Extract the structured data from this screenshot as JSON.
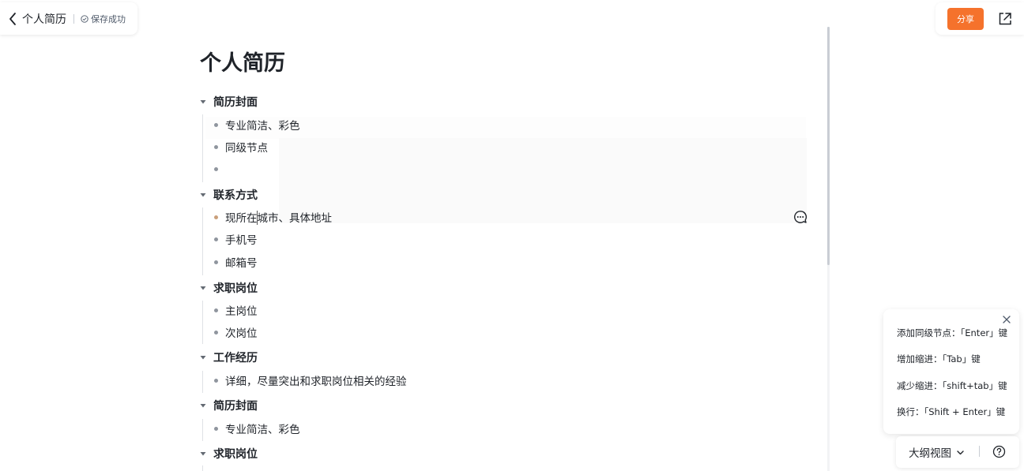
{
  "header": {
    "title": "个人简历",
    "save_status": "保存成功",
    "share_label": "分享",
    "accent_color": "#f5722c"
  },
  "document": {
    "title": "个人简历",
    "sections": [
      {
        "label": "简历封面",
        "items": [
          "专业简洁、彩色",
          "同级节点",
          ""
        ]
      },
      {
        "label": "联系方式",
        "items": [
          "现所在城市、具体地址",
          "手机号",
          "邮箱号"
        ]
      },
      {
        "label": "求职岗位",
        "items": [
          "主岗位",
          "次岗位"
        ]
      },
      {
        "label": "工作经历",
        "items": [
          "详细，尽量突出和求职岗位相关的经验"
        ]
      },
      {
        "label": "简历封面",
        "items": [
          "专业简洁、彩色"
        ]
      },
      {
        "label": "求职岗位",
        "items": []
      }
    ]
  },
  "hints": [
    "添加同级节点：「Enter」键",
    "增加缩进：「Tab」键",
    "减少缩进：「shift+tab」键",
    "换行：「Shift + Enter」键"
  ],
  "view_switcher": {
    "selected": "大纲视图"
  },
  "icons": {
    "back": "chevron-left-icon",
    "saved": "check-circle-icon",
    "open_external": "external-link-icon",
    "comment": "comment-icon",
    "collapse": "caret-down-icon",
    "close": "close-icon",
    "dropdown": "chevron-down-icon",
    "help": "help-circle-icon"
  }
}
